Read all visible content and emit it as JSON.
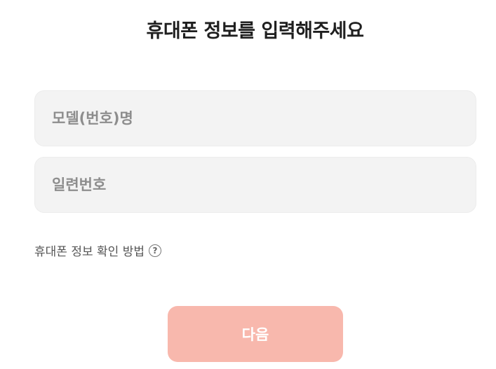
{
  "header": {
    "title": "휴대폰 정보를 입력해주세요"
  },
  "form": {
    "model_field": {
      "value": "",
      "placeholder": "모델(번호)명"
    },
    "serial_field": {
      "value": "",
      "placeholder": "일련번호"
    },
    "help_link": {
      "label": "휴대폰 정보 확인 방법",
      "icon": "question-circle-icon",
      "icon_glyph": "?"
    }
  },
  "footer": {
    "next_label": "다음",
    "next_color": "#f8b8ad"
  }
}
